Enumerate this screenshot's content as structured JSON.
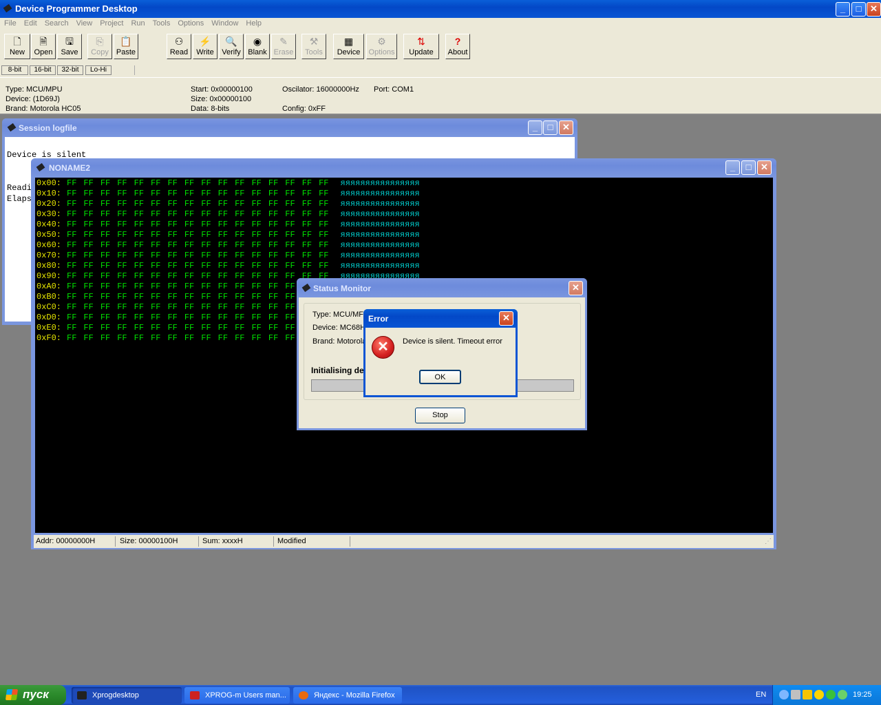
{
  "main_window": {
    "title": "Device Programmer Desktop",
    "menu": [
      "File",
      "Edit",
      "Search",
      "View",
      "Project",
      "Run",
      "Tools",
      "Options",
      "Window",
      "Help"
    ]
  },
  "toolbar": [
    {
      "label": "New",
      "icon": "new-file-icon",
      "enabled": true
    },
    {
      "label": "Open",
      "icon": "open-file-icon",
      "enabled": true
    },
    {
      "label": "Save",
      "icon": "save-icon",
      "enabled": true
    },
    {
      "label": "Copy",
      "icon": "copy-icon",
      "enabled": false
    },
    {
      "label": "Paste",
      "icon": "paste-icon",
      "enabled": true
    },
    {
      "label": "Read",
      "icon": "read-icon",
      "enabled": true
    },
    {
      "label": "Write",
      "icon": "write-icon",
      "enabled": true
    },
    {
      "label": "Verify",
      "icon": "verify-icon",
      "enabled": true
    },
    {
      "label": "Blank",
      "icon": "blank-icon",
      "enabled": true
    },
    {
      "label": "Erase",
      "icon": "erase-icon",
      "enabled": false
    },
    {
      "label": "Tools",
      "icon": "tools-icon",
      "enabled": false
    },
    {
      "label": "Device",
      "icon": "chip-icon",
      "enabled": true
    },
    {
      "label": "Options",
      "icon": "options-icon",
      "enabled": false
    },
    {
      "label": "Update",
      "icon": "update-icon",
      "enabled": true
    },
    {
      "label": "About",
      "icon": "help-icon",
      "enabled": true
    }
  ],
  "view_modes": [
    "8-bit",
    "16-bit",
    "32-bit",
    "Lo-Hi"
  ],
  "info": {
    "type": "Type: MCU/MPU",
    "device": "Device: (1D69J)",
    "brand": "Brand: Motorola HC05",
    "start": "Start: 0x00000100",
    "size": "Size: 0x00000100",
    "data": "Data: 8-bits",
    "oscilator": "Oscilator: 16000000Hz",
    "config": "Config: 0xFF",
    "port": "Port: COM1"
  },
  "logfile": {
    "title": "Session logfile",
    "lines_visible": [
      "Device is silent",
      "",
      "",
      "Readi",
      "Elaps"
    ]
  },
  "editor": {
    "title": "NONAME2",
    "byte_value": "FF",
    "ascii_row": "яяяяяяяяяяяяяяяя",
    "rows": [
      {
        "addr": "0x00:",
        "full": true
      },
      {
        "addr": "0x10:",
        "full": true
      },
      {
        "addr": "0x20:",
        "full": true
      },
      {
        "addr": "0x30:",
        "full": true
      },
      {
        "addr": "0x40:",
        "full": true
      },
      {
        "addr": "0x50:",
        "full": true
      },
      {
        "addr": "0x60:",
        "full": true
      },
      {
        "addr": "0x70:",
        "full": true
      },
      {
        "addr": "0x80:",
        "full": true
      },
      {
        "addr": "0x90:",
        "full": true
      },
      {
        "addr": "0xA0:",
        "full": false
      },
      {
        "addr": "0xB0:",
        "full": false
      },
      {
        "addr": "0xC0:",
        "full": false
      },
      {
        "addr": "0xD0:",
        "full": false
      },
      {
        "addr": "0xE0:",
        "full": false
      },
      {
        "addr": "0xF0:",
        "full": false
      }
    ],
    "status": {
      "addr": "Addr: 00000000H",
      "size": "Size: 00000100H",
      "sum": "Sum: xxxxH",
      "modified": "Modified"
    }
  },
  "status_monitor": {
    "title": "Status Monitor",
    "type": "Type: MCU/MF",
    "device": "Device: MC68H",
    "brand": "Brand: Motorola",
    "progress_label": "Initialising de",
    "stop": "Stop"
  },
  "error_dialog": {
    "title": "Error",
    "message": "Device is silent. Timeout error",
    "ok": "OK"
  },
  "taskbar": {
    "start": "пуск",
    "items": [
      {
        "label": "Xprogdesktop",
        "active": true
      },
      {
        "label": "XPROG-m Users man...",
        "active": false
      },
      {
        "label": "Яндекс - Mozilla Firefox",
        "active": false
      }
    ],
    "lang": "EN",
    "clock": "19:25"
  },
  "colors": {
    "hex_address": "#e8e800",
    "hex_bytes": "#00e000",
    "hex_ascii": "#00c8c8",
    "error_red": "#d42020"
  }
}
